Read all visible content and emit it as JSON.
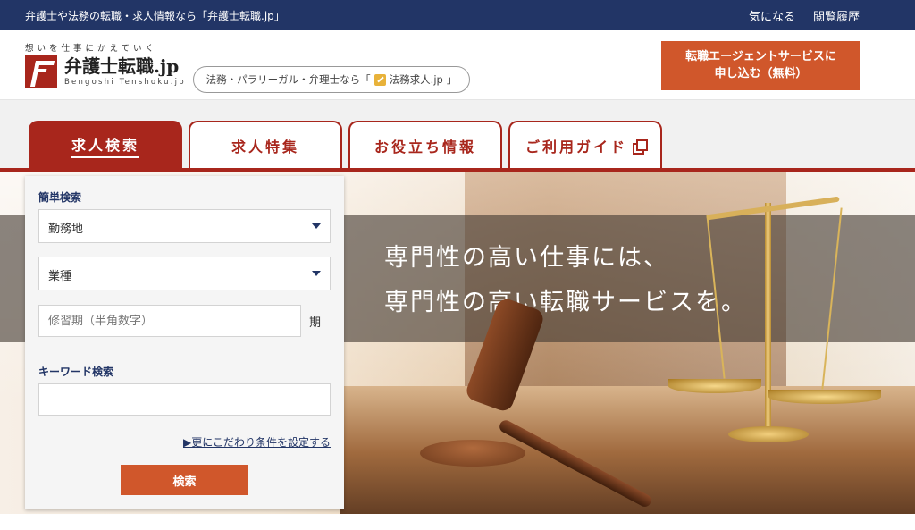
{
  "topbar": {
    "tagline": "弁護士や法務の転職・求人情報なら「弁護士転職.jp」",
    "links": [
      "気になる",
      "閲覧履歴"
    ]
  },
  "header": {
    "catchphrase": "想いを仕事にかえていく",
    "logo_main": "弁護士転職.jp",
    "logo_sub": "Bengoshi Tenshoku.jp",
    "sister_prefix": "法務・パラリーガル・弁理士なら「",
    "sister_name": "法務求人.jp",
    "sister_suffix": "」",
    "cta_line1": "転職エージェントサービスに",
    "cta_line2": "申し込む（無料）"
  },
  "nav": {
    "tabs": [
      {
        "label": "求人検索",
        "active": true
      },
      {
        "label": "求人特集",
        "active": false
      },
      {
        "label": "お役立ち情報",
        "active": false
      },
      {
        "label": "ご利用ガイド",
        "active": false,
        "icon": "external-link-icon"
      }
    ]
  },
  "hero": {
    "line1": "専門性の高い仕事には、",
    "line2": "専門性の高い転職サービスを。"
  },
  "search": {
    "simple_title": "簡単検索",
    "location_placeholder": "勤務地",
    "category_placeholder": "業種",
    "term_placeholder": "修習期（半角数字）",
    "term_suffix": "期",
    "keyword_title": "キーワード検索",
    "keyword_value": "",
    "more_link": "▶更にこだわり条件を設定する",
    "submit_label": "検索"
  },
  "colors": {
    "navy": "#223566",
    "brand_red": "#a8261c",
    "cta_orange": "#d0572b"
  }
}
